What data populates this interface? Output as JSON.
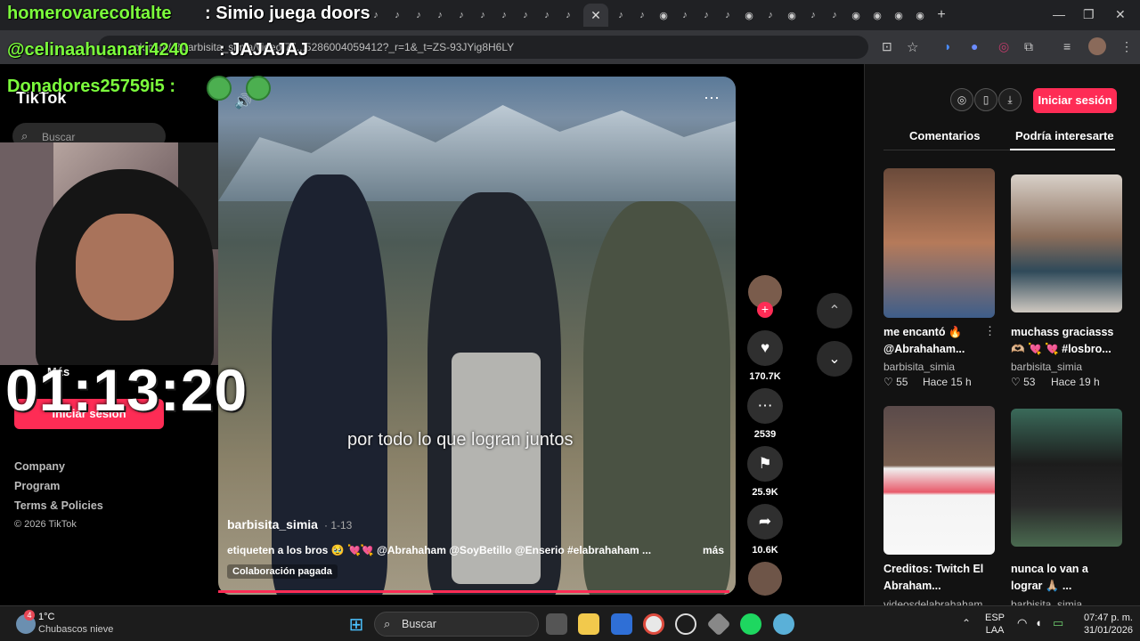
{
  "browser": {
    "tab_active_close": "✕",
    "new_tab": "+",
    "url": "...ok.com/@barbisita_simia/video/75...5286004059412?_r=1&_t=ZS-93JYig8H6LY"
  },
  "overlay": {
    "line1_user": "homerovarecoltalte",
    "line1_msg": ": Simio juega doors",
    "line2_user": "@celinaahuanari4240",
    "line2_msg": ": JAJAJAJ",
    "line3_user": "Donadores25759i5 :",
    "timer": "01:13:20"
  },
  "tiktok": {
    "logo": "TikTok",
    "search_placeholder": "Buscar",
    "mas": "Más",
    "login_left": "Iniciar sesión",
    "links": [
      "Company",
      "Program",
      "Terms & Policies",
      "© 2026 TikTok"
    ],
    "video": {
      "caption": "por todo lo que logran juntos",
      "username": "barbisita_simia",
      "date": "· 1-13",
      "description": "etiqueten a los bros 🥹 💘💘 @Abrahaham @SoyBetillo @Enserio #elabrahaham ...",
      "more": "más",
      "collab": "Colaboración pagada",
      "menu": "⋯",
      "sound": "🔊"
    },
    "actions": [
      {
        "icon": "heart-icon",
        "glyph": "♥",
        "count": "170.7K"
      },
      {
        "icon": "comment-icon",
        "glyph": "⋯",
        "count": "2539"
      },
      {
        "icon": "bookmark-icon",
        "glyph": "⚑",
        "count": "25.9K"
      },
      {
        "icon": "share-icon",
        "glyph": "➦",
        "count": "10.6K"
      }
    ],
    "right": {
      "login": "Iniciar sesión",
      "tab_comments": "Comentarios",
      "tab_suggest": "Podría interesarte",
      "cards": [
        {
          "title": "me encantó 🔥 @Abrahaham...",
          "user": "barbisita_simia",
          "likes": "♡ 55",
          "time": "Hace 15 h"
        },
        {
          "title": "muchass graciasss 🫶🏼 💘 💘 #losbro...",
          "user": "barbisita_simia",
          "likes": "♡ 53",
          "time": "Hace 19 h"
        },
        {
          "title": "Creditos: Twitch El Abraham...",
          "user": "videosdelabrahaham",
          "likes": "",
          "time": ""
        },
        {
          "title": "nunca lo van a lograr 🙏🏼 ...",
          "user": "barbisita_simia",
          "likes": "",
          "time": ""
        }
      ]
    }
  },
  "taskbar": {
    "weather_temp": "1°C",
    "weather_desc": "Chubascos nieve",
    "weather_badge": "4",
    "search": "Buscar",
    "lang1": "ESP",
    "lang2": "LAA",
    "time": "07:47 p. m.",
    "date": "31/01/2026"
  },
  "colors": {
    "accent": "#fe2c55",
    "overlay_green": "#7cff3c"
  }
}
